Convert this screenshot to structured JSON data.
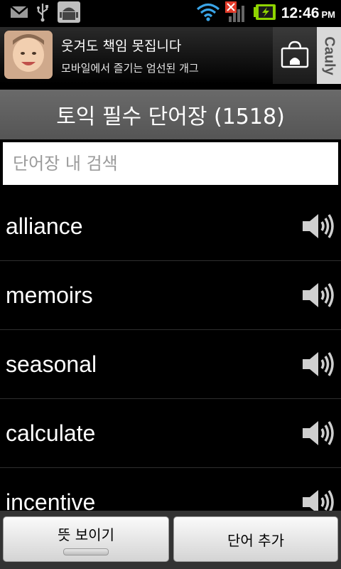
{
  "status_bar": {
    "time": "12:46",
    "ampm": "PM",
    "icons": [
      "gmail-icon",
      "usb-icon",
      "android-debug-icon",
      "wifi-icon",
      "signal-no-service-icon",
      "battery-charging-icon"
    ]
  },
  "ad": {
    "title": "웃겨도 책임 못집니다",
    "subtitle": "모바일에서 즐기는 엄선된 개그",
    "brand": "Cauly"
  },
  "title": "토익 필수 단어장 (1518)",
  "search": {
    "placeholder": "단어장 내 검색",
    "value": ""
  },
  "words": [
    {
      "word": "alliance"
    },
    {
      "word": "memoirs"
    },
    {
      "word": "seasonal"
    },
    {
      "word": "calculate"
    },
    {
      "word": "incentive"
    }
  ],
  "buttons": {
    "show_meaning": "뜻 보이기",
    "add_word": "단어 추가"
  },
  "colors": {
    "background": "#000000",
    "title_bar": "#5e5e5e",
    "wifi": "#3aa5e8",
    "battery": "#8fd400"
  }
}
